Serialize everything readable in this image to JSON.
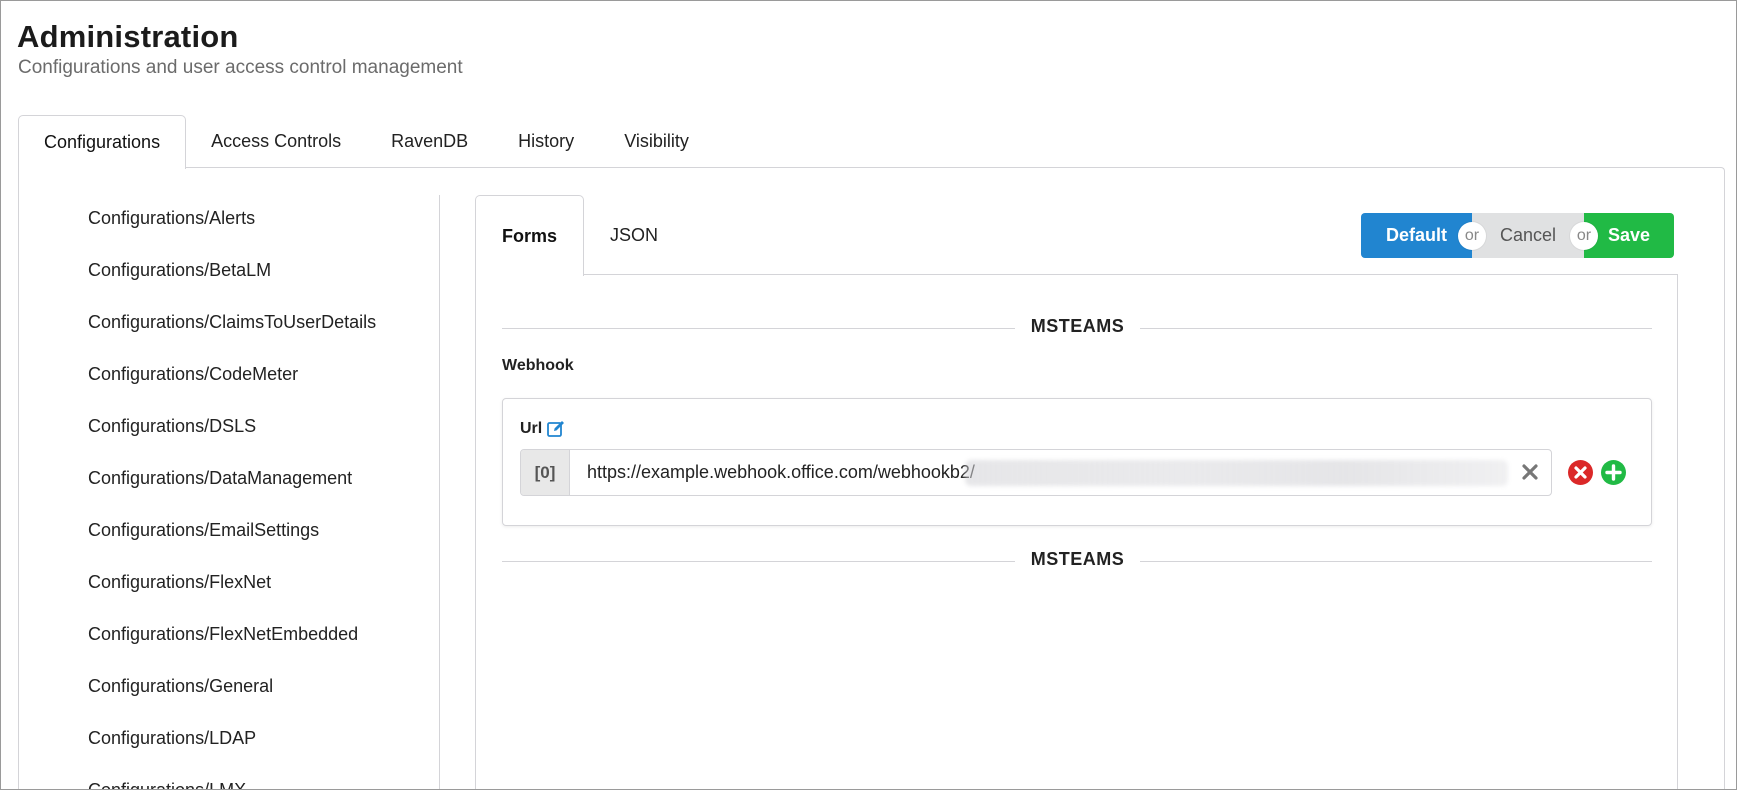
{
  "header": {
    "title": "Administration",
    "subtitle": "Configurations and user access control management"
  },
  "top_tabs": [
    {
      "label": "Configurations",
      "active": true
    },
    {
      "label": "Access Controls",
      "active": false
    },
    {
      "label": "RavenDB",
      "active": false
    },
    {
      "label": "History",
      "active": false
    },
    {
      "label": "Visibility",
      "active": false
    }
  ],
  "sidebar": {
    "items": [
      "Configurations/Alerts",
      "Configurations/BetaLM",
      "Configurations/ClaimsToUserDetails",
      "Configurations/CodeMeter",
      "Configurations/DSLS",
      "Configurations/DataManagement",
      "Configurations/EmailSettings",
      "Configurations/FlexNet",
      "Configurations/FlexNetEmbedded",
      "Configurations/General",
      "Configurations/LDAP",
      "Configurations/LMX"
    ]
  },
  "inner_tabs": [
    {
      "label": "Forms",
      "active": true
    },
    {
      "label": "JSON",
      "active": false
    }
  ],
  "actions": {
    "default_label": "Default",
    "or_label": "or",
    "cancel_label": "Cancel",
    "save_label": "Save"
  },
  "form": {
    "section_title": "MSTEAMS",
    "section_footer": "MSTEAMS",
    "webhook_label": "Webhook",
    "url_label": "Url",
    "urls": [
      {
        "index": "[0]",
        "value": "https://example.webhook.office.com/webhookb2/"
      }
    ]
  },
  "colors": {
    "primary": "#2185d0",
    "positive": "#21ba45",
    "negative": "#db2828",
    "neutral": "#e0e1e2"
  }
}
